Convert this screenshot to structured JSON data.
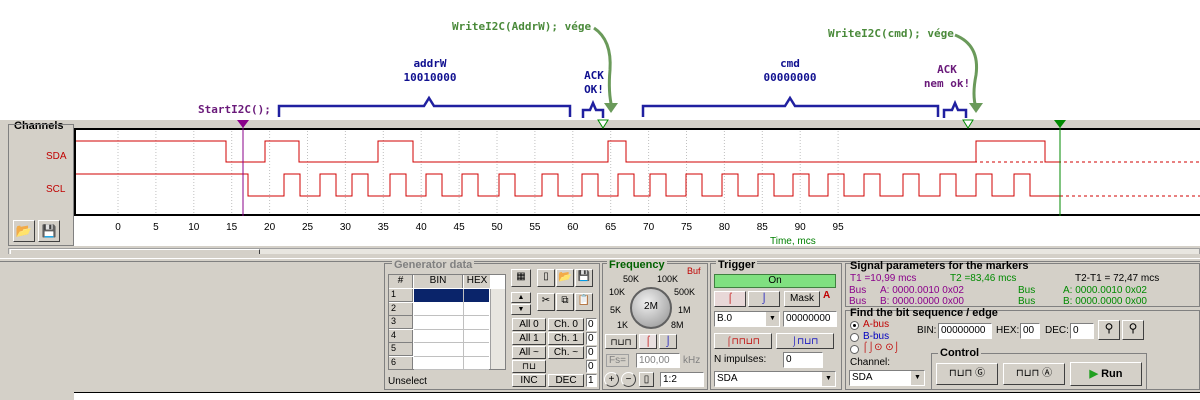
{
  "annotations": {
    "start": "StartI2C();",
    "addr_name": "addrW",
    "addr_bits": "10010000",
    "ack1_title": "ACK",
    "ack1_status": "OK!",
    "write_addr": "WriteI2C(AddrW); vége",
    "cmd_name": "cmd",
    "cmd_bits": "00000000",
    "ack2_title": "ACK",
    "ack2_status": "nem ok!",
    "write_cmd": "WriteI2C(cmd); vége"
  },
  "scope": {
    "channels_title": "Channels",
    "channels": [
      "SDA",
      "SCL"
    ],
    "x_ticks": [
      "0",
      "5",
      "10",
      "15",
      "20",
      "25",
      "30",
      "35",
      "40",
      "45",
      "50",
      "55",
      "60",
      "65",
      "70",
      "75",
      "80",
      "85",
      "90",
      "95"
    ],
    "x_label": "Time, mcs",
    "markers": [
      "1",
      "2"
    ],
    "colors": {
      "signal": "#d00000",
      "marker1": "#8a008a",
      "marker2": "#008a00"
    }
  },
  "generator": {
    "title": "Generator data",
    "cols": [
      "#",
      "BIN",
      "HEX"
    ],
    "rows": [
      "1",
      "2",
      "3",
      "4",
      "5",
      "6"
    ],
    "all0": "All 0",
    "all1": "All 1",
    "all_inv": "All ~",
    "ch0": "Ch. 0",
    "ch1": "Ch. 1",
    "ch_inv": "Ch. ~",
    "inc": "INC",
    "dec": "DEC",
    "unselect": "Unselect",
    "counts": [
      "0",
      "0",
      "0",
      "0",
      "1"
    ]
  },
  "frequency": {
    "title": "Frequency",
    "buf": "Buf",
    "dial_labels": [
      "50K",
      "100K",
      "10K",
      "500K",
      "5K",
      "1M",
      "1K",
      "8M"
    ],
    "dial_value": "2M",
    "fs_label": "Fs=",
    "fs_value": "100,00",
    "fs_unit": "kHz",
    "zoom": "1:2"
  },
  "trigger": {
    "title": "Trigger",
    "state": "On",
    "mask": "Mask",
    "bit_select": "B.0",
    "bit_value": "00000000",
    "n_impulses_label": "N impulses:",
    "n_impulses": "0",
    "channel": "SDA"
  },
  "signal_params": {
    "title": "Signal parameters for the markers",
    "t1": "T1 =10,99 mcs",
    "t2": "T2 =83,46 mcs",
    "dt": "T2-T1 = 72,47 mcs",
    "bus_a1": "A: 0000.0010  0x02",
    "bus_b1": "B: 0000.0000  0x00",
    "bus_a2": "A: 0000.0010  0x02",
    "bus_b2": "B: 0000.0000  0x00",
    "bus_label": "Bus"
  },
  "find": {
    "title": "Find the bit sequence / edge",
    "a_bus": "A-bus",
    "b_bus": "B-bus",
    "bin_label": "BIN:",
    "bin_value": "00000000",
    "hex_label": "HEX:",
    "hex_value": "00",
    "dec_label": "DEC:",
    "dec_value": "0",
    "channel_label": "Channel:",
    "channel": "SDA"
  },
  "control": {
    "title": "Control",
    "run": "Run"
  }
}
